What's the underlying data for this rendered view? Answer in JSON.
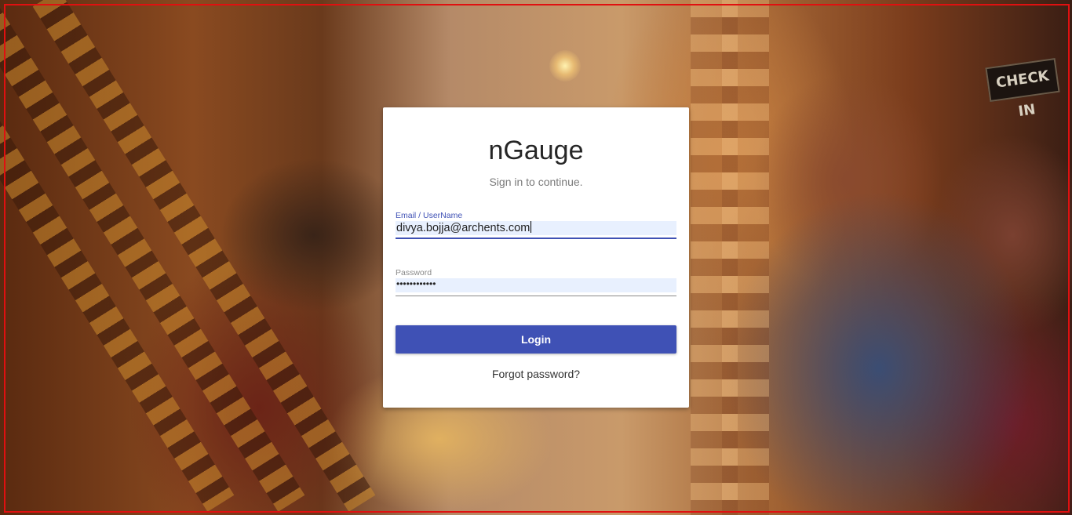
{
  "app": {
    "title": "nGauge",
    "subtitle": "Sign in to continue."
  },
  "form": {
    "email_label": "Email / UserName",
    "email_value": "divya.bojja@archents.com",
    "password_label": "Password",
    "password_value": "••••••••••••",
    "login_label": "Login",
    "forgot_label": "Forgot password?"
  },
  "background": {
    "sign_text": "CHECK IN"
  },
  "colors": {
    "accent": "#3f51b5",
    "frame": "#e01010",
    "autofill": "#e8f0fe"
  }
}
